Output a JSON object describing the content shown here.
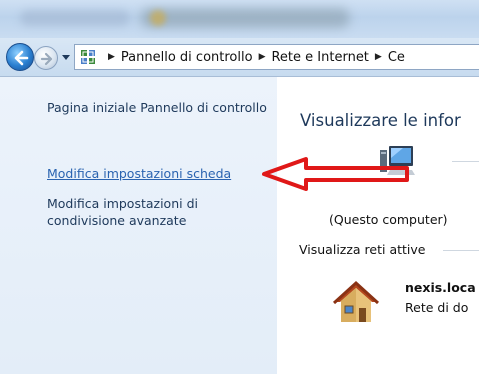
{
  "breadcrumb": {
    "items": [
      "Pannello di controllo",
      "Rete e Internet",
      "Ce"
    ]
  },
  "sidebar": {
    "home_link": "Pagina iniziale Pannello di controllo",
    "adapter_settings_link": "Modifica impostazioni scheda",
    "sharing_settings_link": "Modifica impostazioni di condivisione avanzate"
  },
  "main": {
    "heading": "Visualizzare le infor",
    "computer_caption": "(Questo computer)",
    "active_networks_label": "Visualizza reti attive",
    "network": {
      "name": "nexis.loca",
      "type": "Rete di do"
    }
  },
  "colors": {
    "link": "#2a63b0",
    "heading": "#1e395b",
    "annotation_arrow": "#e01818",
    "sidebar_bg": "#e9f1fa"
  },
  "icons": [
    "back-arrow-icon",
    "forward-arrow-icon",
    "control-panel-icon",
    "computer-icon",
    "home-network-icon"
  ]
}
